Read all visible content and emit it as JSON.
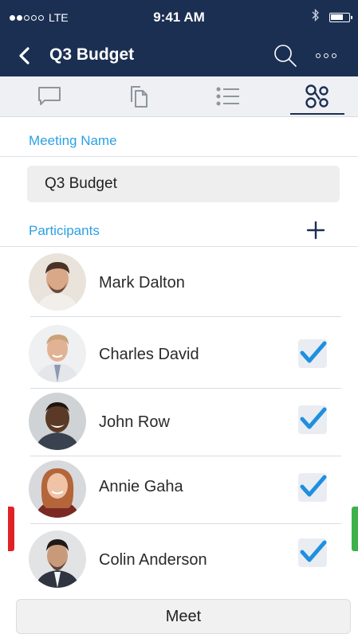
{
  "status_bar": {
    "carrier": "LTE",
    "signal_dots_filled": 2,
    "signal_dots_total": 5,
    "time": "9:41 AM",
    "bluetooth_icon": "bluetooth-icon",
    "battery_level": 0.75
  },
  "nav": {
    "back_icon": "chevron-left-icon",
    "title": "Q3 Budget",
    "search_icon": "search-icon",
    "more_icon": "more-horizontal-icon"
  },
  "tabs": [
    {
      "icon": "chat-bubble-icon",
      "active": false
    },
    {
      "icon": "copy-document-icon",
      "active": false
    },
    {
      "icon": "list-icon",
      "active": false
    },
    {
      "icon": "participants-network-icon",
      "active": true
    }
  ],
  "meeting": {
    "label": "Meeting Name",
    "value": "Q3 Budget"
  },
  "participants": {
    "label": "Participants",
    "add_icon": "plus-icon",
    "items": [
      {
        "name": "Mark Dalton",
        "checked": false,
        "show_checkbox": false
      },
      {
        "name": "Charles David",
        "checked": true,
        "show_checkbox": true
      },
      {
        "name": "John Row",
        "checked": true,
        "show_checkbox": true
      },
      {
        "name": "Annie Gaha",
        "checked": true,
        "show_checkbox": true
      },
      {
        "name": "Colin Anderson",
        "checked": true,
        "show_checkbox": true
      }
    ]
  },
  "meet_button": "Meet",
  "colors": {
    "nav_bg": "#1b2f52",
    "accent_blue": "#2ba1e3",
    "check_blue": "#1f8fe0",
    "side_red": "#e02228",
    "side_green": "#3db24b"
  }
}
